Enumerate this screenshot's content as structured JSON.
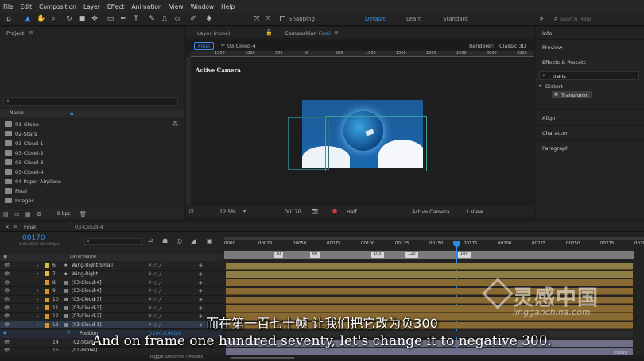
{
  "menu": [
    "File",
    "Edit",
    "Composition",
    "Layer",
    "Effect",
    "Animation",
    "View",
    "Window",
    "Help"
  ],
  "toolbar": {
    "snapping_label": "Snapping",
    "workspaces": [
      "Default",
      "Learn",
      "Standard"
    ],
    "search_placeholder": "Search Help"
  },
  "project": {
    "tab": "Project",
    "search_placeholder": "",
    "column_name": "Name",
    "items": [
      "01-Globe",
      "02-Stars",
      "03-Cloud-1",
      "03-Cloud-2",
      "03-Cloud-3",
      "03-Cloud-4",
      "04-Paper Airplane",
      "Final",
      "Images"
    ],
    "bpc": "8 bpc"
  },
  "viewer": {
    "layer_tab": "Layer (none)",
    "comp_tab": "Composition",
    "comp_name": "Final",
    "breadcrumb_a": "Final",
    "breadcrumb_b": "03-Cloud-4",
    "renderer_label": "Renderer:",
    "renderer_value": "Classic 3D",
    "active_camera": "Active Camera",
    "ruler": [
      "1500",
      "1000",
      "500",
      "0",
      "500",
      "1000",
      "1500",
      "2000",
      "2500",
      "3000",
      "3500"
    ],
    "zoom": "12.5%",
    "timecode": "00170",
    "resolution": "Half",
    "camera": "Active Camera",
    "view": "1 View"
  },
  "right_panel": {
    "info": "Info",
    "preview": "Preview",
    "effects_presets": "Effects & Presets",
    "search_value": "trans",
    "category": "Distort",
    "effect_item": "Transform",
    "align": "Align",
    "character": "Character",
    "paragraph": "Paragraph"
  },
  "timeline": {
    "tab_final": "Final",
    "tab_cloud": "03-Cloud-4",
    "current_time": "00170",
    "time_sub": "0:00:05:20 (30.00 fps)",
    "column_layer_name": "Layer Name",
    "ruler": [
      "0000",
      "00025",
      "00050",
      "00075",
      "00100",
      "00125",
      "00150",
      "00175",
      "00200",
      "00225",
      "00250",
      "00275",
      "0030"
    ],
    "markers": [
      "30",
      "60",
      "105",
      "120",
      "160"
    ],
    "layers": [
      {
        "num": "6",
        "name": "Wing-Right-Small",
        "color": "#d9c23a",
        "star": true
      },
      {
        "num": "7",
        "name": "Wing-Right",
        "color": "#d9c23a",
        "star": true
      },
      {
        "num": "8",
        "name": "[03-Cloud-4]",
        "color": "#e0922c",
        "star": false
      },
      {
        "num": "9",
        "name": "[03-Cloud-4]",
        "color": "#e0922c",
        "star": false
      },
      {
        "num": "10",
        "name": "[03-Cloud-3]",
        "color": "#e0922c",
        "star": false
      },
      {
        "num": "11",
        "name": "[03-Cloud-3]",
        "color": "#e0922c",
        "star": false
      },
      {
        "num": "12",
        "name": "[03-Cloud-2]",
        "color": "#e0922c",
        "star": false
      },
      {
        "num": "13",
        "name": "[03-Cloud-1]",
        "color": "#e0922c",
        "star": false
      }
    ],
    "property_name": "Position",
    "property_value": "1200.0,690.0",
    "bottom_layers": [
      {
        "num": "14",
        "name": "[02-Stars]"
      },
      {
        "num": "15",
        "name": "[01-Globe]"
      }
    ],
    "toggle_label": "Toggle Switches / Modes"
  },
  "subtitles": {
    "chinese": "而在第一百七十帧 让我们把它改为负300",
    "english": "And on frame one hundred seventy, let's change it to negative 300."
  },
  "watermark": {
    "cn": "灵感中国",
    "en": "lingganchina.com",
    "udemy": "Udemy"
  },
  "colors": {
    "accent": "#2d8ceb",
    "layer_bar": "#8a6a33",
    "layer_bar_top": "#8c7e45",
    "selection": "#3a5a8a"
  }
}
